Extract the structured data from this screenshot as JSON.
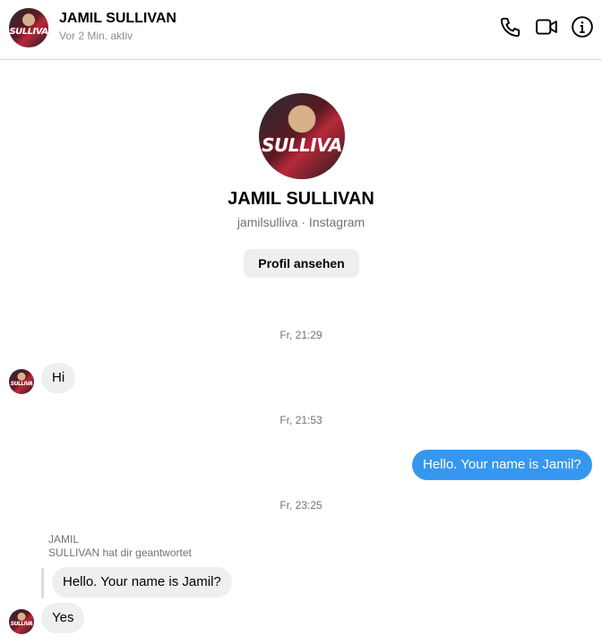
{
  "header": {
    "name": "JAMIL SULLIVAN",
    "status": "Vor 2 Min. aktiv",
    "avatar_text": "SULLIVA",
    "icons": [
      "phone-icon",
      "video-camera-icon",
      "info-icon"
    ]
  },
  "profile": {
    "name": "JAMIL SULLIVAN",
    "subtitle": "jamilsulliva · Instagram",
    "button_label": "Profil ansehen",
    "avatar_text": "SULLIVA"
  },
  "thread": {
    "timestamps": [
      "Fr, 21:29",
      "Fr, 21:53",
      "Fr, 23:25"
    ],
    "messages": [
      {
        "text": "Hi",
        "direction": "incoming"
      },
      {
        "text": "Hello. Your name is Jamil?",
        "direction": "outgoing"
      },
      {
        "text": "Yes",
        "direction": "incoming"
      }
    ],
    "reply_context": {
      "line1": "JAMIL",
      "line2": "SULLIVAN hat dir geantwortet",
      "quoted": "Hello. Your name is Jamil?"
    }
  },
  "colors": {
    "outgoing_bubble": "#3797f0",
    "incoming_bubble": "#efefef",
    "secondary_text": "#737373",
    "divider": "#dbdbdb"
  }
}
